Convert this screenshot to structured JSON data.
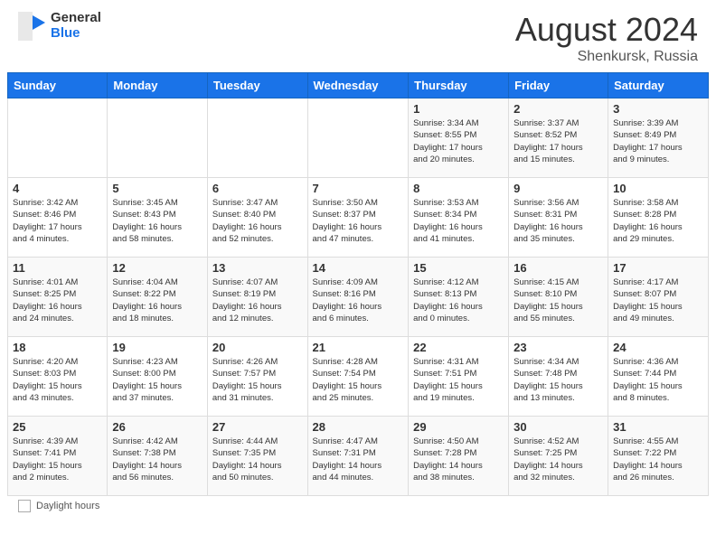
{
  "header": {
    "logo_general": "General",
    "logo_blue": "Blue",
    "month_year": "August 2024",
    "location": "Shenkursk, Russia"
  },
  "days_of_week": [
    "Sunday",
    "Monday",
    "Tuesday",
    "Wednesday",
    "Thursday",
    "Friday",
    "Saturday"
  ],
  "footer": {
    "label": "Daylight hours"
  },
  "weeks": [
    [
      {
        "day": "",
        "info": ""
      },
      {
        "day": "",
        "info": ""
      },
      {
        "day": "",
        "info": ""
      },
      {
        "day": "",
        "info": ""
      },
      {
        "day": "1",
        "info": "Sunrise: 3:34 AM\nSunset: 8:55 PM\nDaylight: 17 hours\nand 20 minutes."
      },
      {
        "day": "2",
        "info": "Sunrise: 3:37 AM\nSunset: 8:52 PM\nDaylight: 17 hours\nand 15 minutes."
      },
      {
        "day": "3",
        "info": "Sunrise: 3:39 AM\nSunset: 8:49 PM\nDaylight: 17 hours\nand 9 minutes."
      }
    ],
    [
      {
        "day": "4",
        "info": "Sunrise: 3:42 AM\nSunset: 8:46 PM\nDaylight: 17 hours\nand 4 minutes."
      },
      {
        "day": "5",
        "info": "Sunrise: 3:45 AM\nSunset: 8:43 PM\nDaylight: 16 hours\nand 58 minutes."
      },
      {
        "day": "6",
        "info": "Sunrise: 3:47 AM\nSunset: 8:40 PM\nDaylight: 16 hours\nand 52 minutes."
      },
      {
        "day": "7",
        "info": "Sunrise: 3:50 AM\nSunset: 8:37 PM\nDaylight: 16 hours\nand 47 minutes."
      },
      {
        "day": "8",
        "info": "Sunrise: 3:53 AM\nSunset: 8:34 PM\nDaylight: 16 hours\nand 41 minutes."
      },
      {
        "day": "9",
        "info": "Sunrise: 3:56 AM\nSunset: 8:31 PM\nDaylight: 16 hours\nand 35 minutes."
      },
      {
        "day": "10",
        "info": "Sunrise: 3:58 AM\nSunset: 8:28 PM\nDaylight: 16 hours\nand 29 minutes."
      }
    ],
    [
      {
        "day": "11",
        "info": "Sunrise: 4:01 AM\nSunset: 8:25 PM\nDaylight: 16 hours\nand 24 minutes."
      },
      {
        "day": "12",
        "info": "Sunrise: 4:04 AM\nSunset: 8:22 PM\nDaylight: 16 hours\nand 18 minutes."
      },
      {
        "day": "13",
        "info": "Sunrise: 4:07 AM\nSunset: 8:19 PM\nDaylight: 16 hours\nand 12 minutes."
      },
      {
        "day": "14",
        "info": "Sunrise: 4:09 AM\nSunset: 8:16 PM\nDaylight: 16 hours\nand 6 minutes."
      },
      {
        "day": "15",
        "info": "Sunrise: 4:12 AM\nSunset: 8:13 PM\nDaylight: 16 hours\nand 0 minutes."
      },
      {
        "day": "16",
        "info": "Sunrise: 4:15 AM\nSunset: 8:10 PM\nDaylight: 15 hours\nand 55 minutes."
      },
      {
        "day": "17",
        "info": "Sunrise: 4:17 AM\nSunset: 8:07 PM\nDaylight: 15 hours\nand 49 minutes."
      }
    ],
    [
      {
        "day": "18",
        "info": "Sunrise: 4:20 AM\nSunset: 8:03 PM\nDaylight: 15 hours\nand 43 minutes."
      },
      {
        "day": "19",
        "info": "Sunrise: 4:23 AM\nSunset: 8:00 PM\nDaylight: 15 hours\nand 37 minutes."
      },
      {
        "day": "20",
        "info": "Sunrise: 4:26 AM\nSunset: 7:57 PM\nDaylight: 15 hours\nand 31 minutes."
      },
      {
        "day": "21",
        "info": "Sunrise: 4:28 AM\nSunset: 7:54 PM\nDaylight: 15 hours\nand 25 minutes."
      },
      {
        "day": "22",
        "info": "Sunrise: 4:31 AM\nSunset: 7:51 PM\nDaylight: 15 hours\nand 19 minutes."
      },
      {
        "day": "23",
        "info": "Sunrise: 4:34 AM\nSunset: 7:48 PM\nDaylight: 15 hours\nand 13 minutes."
      },
      {
        "day": "24",
        "info": "Sunrise: 4:36 AM\nSunset: 7:44 PM\nDaylight: 15 hours\nand 8 minutes."
      }
    ],
    [
      {
        "day": "25",
        "info": "Sunrise: 4:39 AM\nSunset: 7:41 PM\nDaylight: 15 hours\nand 2 minutes."
      },
      {
        "day": "26",
        "info": "Sunrise: 4:42 AM\nSunset: 7:38 PM\nDaylight: 14 hours\nand 56 minutes."
      },
      {
        "day": "27",
        "info": "Sunrise: 4:44 AM\nSunset: 7:35 PM\nDaylight: 14 hours\nand 50 minutes."
      },
      {
        "day": "28",
        "info": "Sunrise: 4:47 AM\nSunset: 7:31 PM\nDaylight: 14 hours\nand 44 minutes."
      },
      {
        "day": "29",
        "info": "Sunrise: 4:50 AM\nSunset: 7:28 PM\nDaylight: 14 hours\nand 38 minutes."
      },
      {
        "day": "30",
        "info": "Sunrise: 4:52 AM\nSunset: 7:25 PM\nDaylight: 14 hours\nand 32 minutes."
      },
      {
        "day": "31",
        "info": "Sunrise: 4:55 AM\nSunset: 7:22 PM\nDaylight: 14 hours\nand 26 minutes."
      }
    ]
  ]
}
